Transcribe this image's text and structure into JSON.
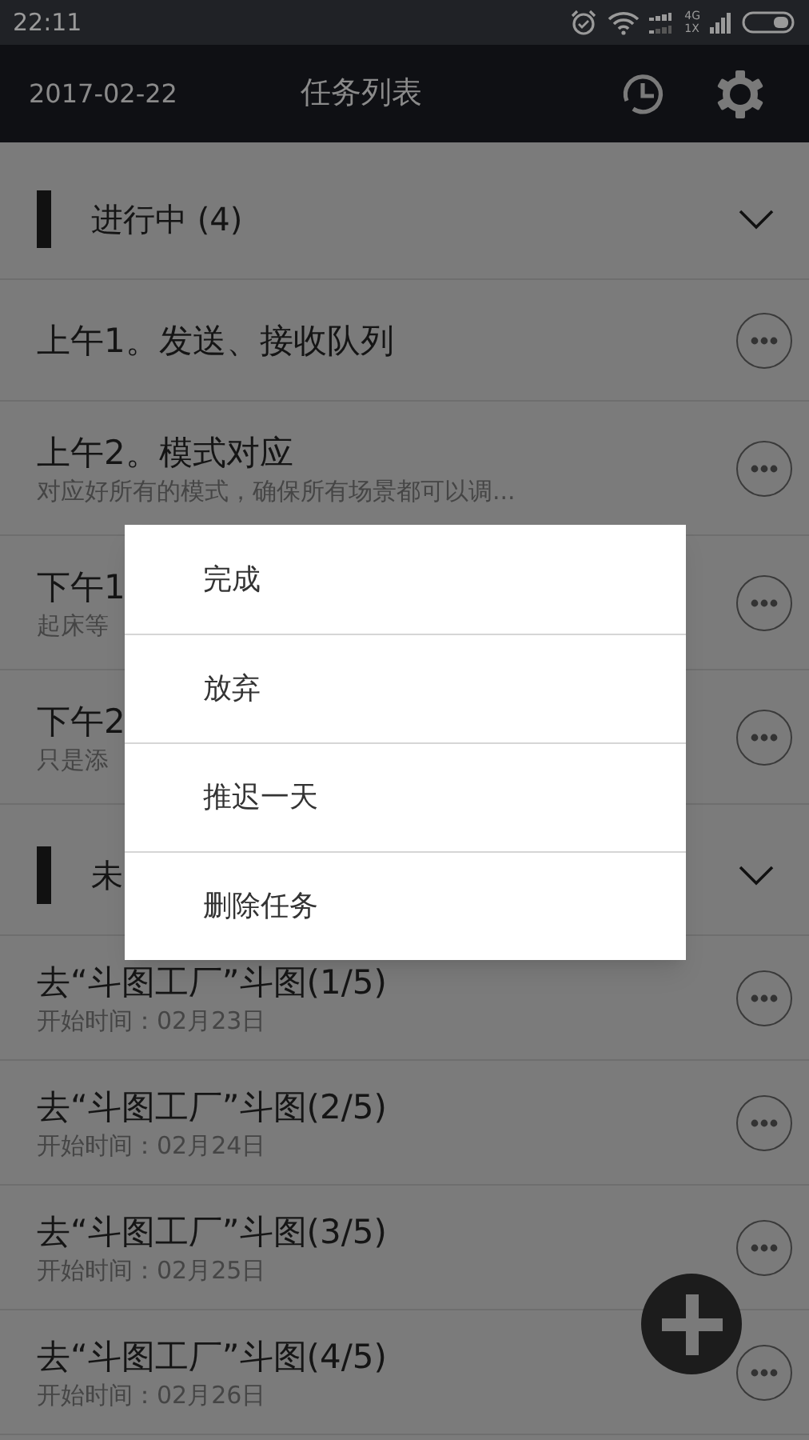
{
  "status_bar": {
    "time": "22:11",
    "network_top": "4G",
    "network_bottom": "1X"
  },
  "app_bar": {
    "date": "2017-02-22",
    "title": "任务列表"
  },
  "sections": [
    {
      "title": "进行中 (4)",
      "expanded": true,
      "tasks": [
        {
          "title": "上午1。发送、接收队列"
        },
        {
          "title": "上午2。模式对应",
          "subtitle": "对应好所有的模式，确保所有场景都可以调..."
        },
        {
          "title": "下午1",
          "subtitle": "起床等"
        },
        {
          "title": "下午2",
          "subtitle": "只是添"
        }
      ]
    },
    {
      "title": "未",
      "expanded": true,
      "tasks": [
        {
          "title": "去“斗图工厂”斗图(1/5)",
          "subtitle": "开始时间：02月23日"
        },
        {
          "title": "去“斗图工厂”斗图(2/5)",
          "subtitle": "开始时间：02月24日"
        },
        {
          "title": "去“斗图工厂”斗图(3/5)",
          "subtitle": "开始时间：02月25日"
        },
        {
          "title": "去“斗图工厂”斗图(4/5)",
          "subtitle": "开始时间：02月26日"
        }
      ]
    }
  ],
  "context_menu": {
    "items": [
      "完成",
      "放弃",
      "推迟一天",
      "删除任务"
    ]
  }
}
